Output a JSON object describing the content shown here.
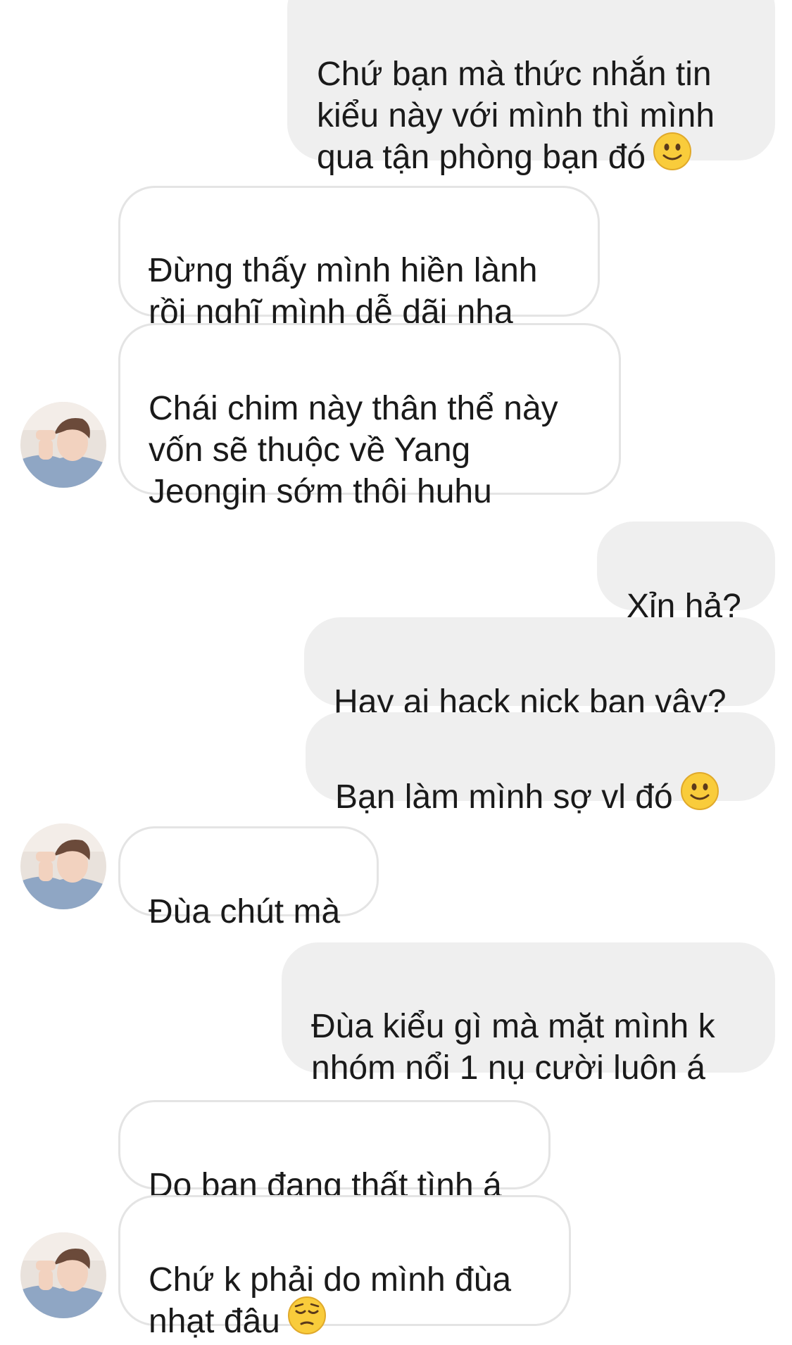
{
  "conversation": {
    "messages": [
      {
        "side": "sent",
        "text": "Chứ bạn mà thức nhắn tin\nkiểu này với mình thì mình\nqua tận phòng bạn đó",
        "emoji": "slightly-smiling-face"
      },
      {
        "side": "received",
        "text": "Đừng thấy mình hiền lành\nrồi nghĩ mình dễ dãi nha"
      },
      {
        "side": "received",
        "text": "Chái chim này thân thể này\nvốn sẽ thuộc về Yang\nJeongin sớm thôi huhu"
      },
      {
        "side": "sent",
        "text": "Xỉn hả?"
      },
      {
        "side": "sent",
        "text": "Hay ai hack nick bạn vậy?"
      },
      {
        "side": "sent",
        "text": "Bạn làm mình sợ vl đó",
        "emoji": "slightly-smiling-face"
      },
      {
        "side": "received",
        "text": "Đùa chút mà"
      },
      {
        "side": "sent",
        "text": "Đùa kiểu gì mà mặt mình k\nnhóm nổi 1 nụ cười luôn á"
      },
      {
        "side": "received",
        "text": "Do bạn đang thất tình á"
      },
      {
        "side": "received",
        "text": "Chứ k phải do mình đùa\nnhạt đâu",
        "emoji": "pensive-face"
      }
    ]
  },
  "colors": {
    "sent_bubble": "#efefef",
    "received_bubble_border": "#e4e4e4",
    "text": "#1a1a1a",
    "emoji_yellow": "#f9cc3b"
  },
  "icons": {
    "avatar": "contact-avatar-photo",
    "smile": "slightly-smiling-face-emoji",
    "pensive": "pensive-face-emoji"
  }
}
